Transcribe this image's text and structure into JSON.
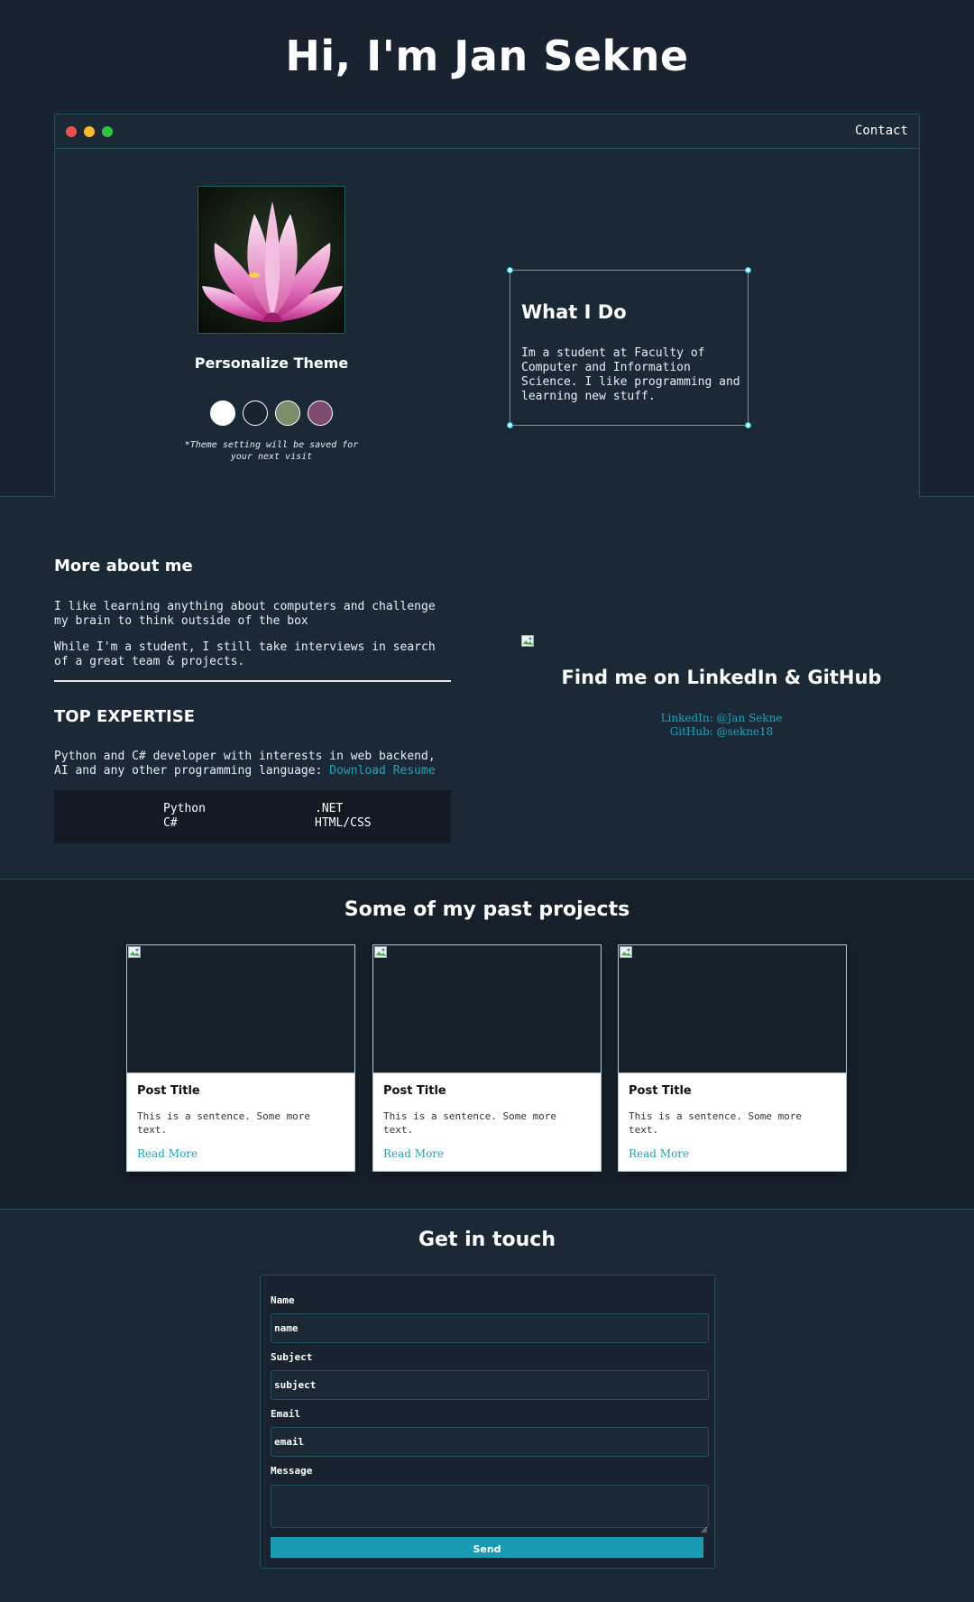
{
  "hero": {
    "title": "Hi, I'm Jan Sekne",
    "contact_label": "Contact",
    "personalize_title": "Personalize Theme",
    "theme_note": "*Theme setting will be saved for your next visit",
    "theme_swatches": [
      "#ffffff",
      "#18232f",
      "#7a8c6a",
      "#7e4a6d"
    ],
    "what_i_do": {
      "title": "What I Do",
      "text": "Im a student at Faculty of Computer and Information Science. I like programming and learning new stuff."
    }
  },
  "about": {
    "title": "More about me",
    "paragraphs": [
      "I like learning anything about computers and challenge my brain to think outside of the box",
      "While I'm a student, I still take interviews in search of a great team & projects."
    ],
    "expertise_title": "TOP EXPERTISE",
    "expertise_text": "Python and C# developer with interests in web backend, AI and any other programming language:",
    "resume_link": "Download Resume",
    "skills": [
      "Python",
      "C#",
      ".NET",
      "HTML/CSS"
    ],
    "social_title": "Find me on LinkedIn & GitHub",
    "linkedin": "LinkedIn: @Jan Sekne",
    "github": "GitHub: @sekne18"
  },
  "projects": {
    "title": "Some of my past projects",
    "cards": [
      {
        "title": "Post Title",
        "text": "This is a sentence. Some more text.",
        "link": "Read More"
      },
      {
        "title": "Post Title",
        "text": "This is a sentence. Some more text.",
        "link": "Read More"
      },
      {
        "title": "Post Title",
        "text": "This is a sentence. Some more text.",
        "link": "Read More"
      }
    ]
  },
  "contact": {
    "title": "Get in touch",
    "name_label": "Name",
    "name_placeholder": "name",
    "subject_label": "Subject",
    "subject_placeholder": "subject",
    "email_label": "Email",
    "email_placeholder": "email",
    "message_label": "Message",
    "send_label": "Send"
  },
  "colors": {
    "background": "#18232f",
    "panel": "#1b2937",
    "accent": "#1a9bb2",
    "border": "#23505a"
  }
}
